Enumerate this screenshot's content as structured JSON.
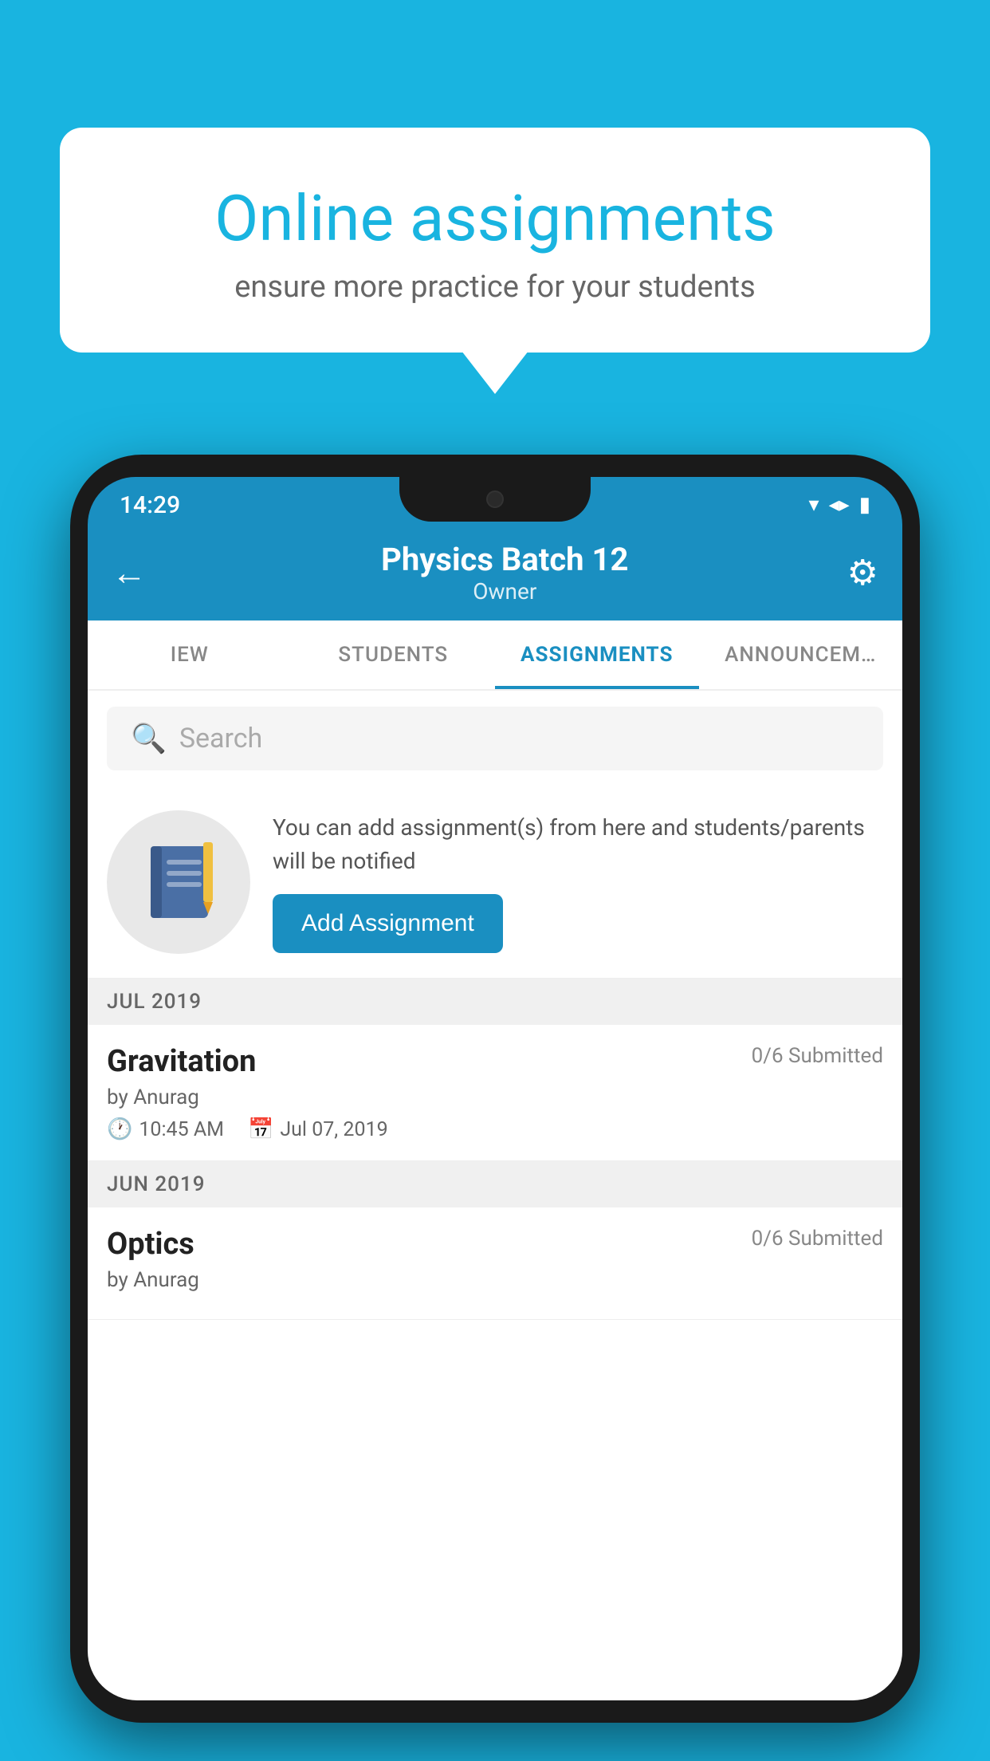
{
  "background_color": "#19b4e0",
  "promo": {
    "title": "Online assignments",
    "subtitle": "ensure more practice for your students"
  },
  "status_bar": {
    "time": "14:29",
    "wifi_icon": "▼",
    "signal_icon": "▲",
    "battery_icon": "▮"
  },
  "app_bar": {
    "title": "Physics Batch 12",
    "subtitle": "Owner",
    "back_icon": "←",
    "settings_icon": "⚙"
  },
  "tabs": [
    {
      "label": "IEW",
      "active": false
    },
    {
      "label": "STUDENTS",
      "active": false
    },
    {
      "label": "ASSIGNMENTS",
      "active": true
    },
    {
      "label": "ANNOUNCEM…",
      "active": false
    }
  ],
  "search": {
    "placeholder": "Search"
  },
  "add_promo": {
    "description": "You can add assignment(s) from here and students/parents will be notified",
    "button_label": "Add Assignment"
  },
  "sections": [
    {
      "label": "JUL 2019",
      "assignments": [
        {
          "name": "Gravitation",
          "submitted": "0/6 Submitted",
          "by": "by Anurag",
          "time": "10:45 AM",
          "date": "Jul 07, 2019"
        }
      ]
    },
    {
      "label": "JUN 2019",
      "assignments": [
        {
          "name": "Optics",
          "submitted": "0/6 Submitted",
          "by": "by Anurag",
          "time": "",
          "date": ""
        }
      ]
    }
  ]
}
